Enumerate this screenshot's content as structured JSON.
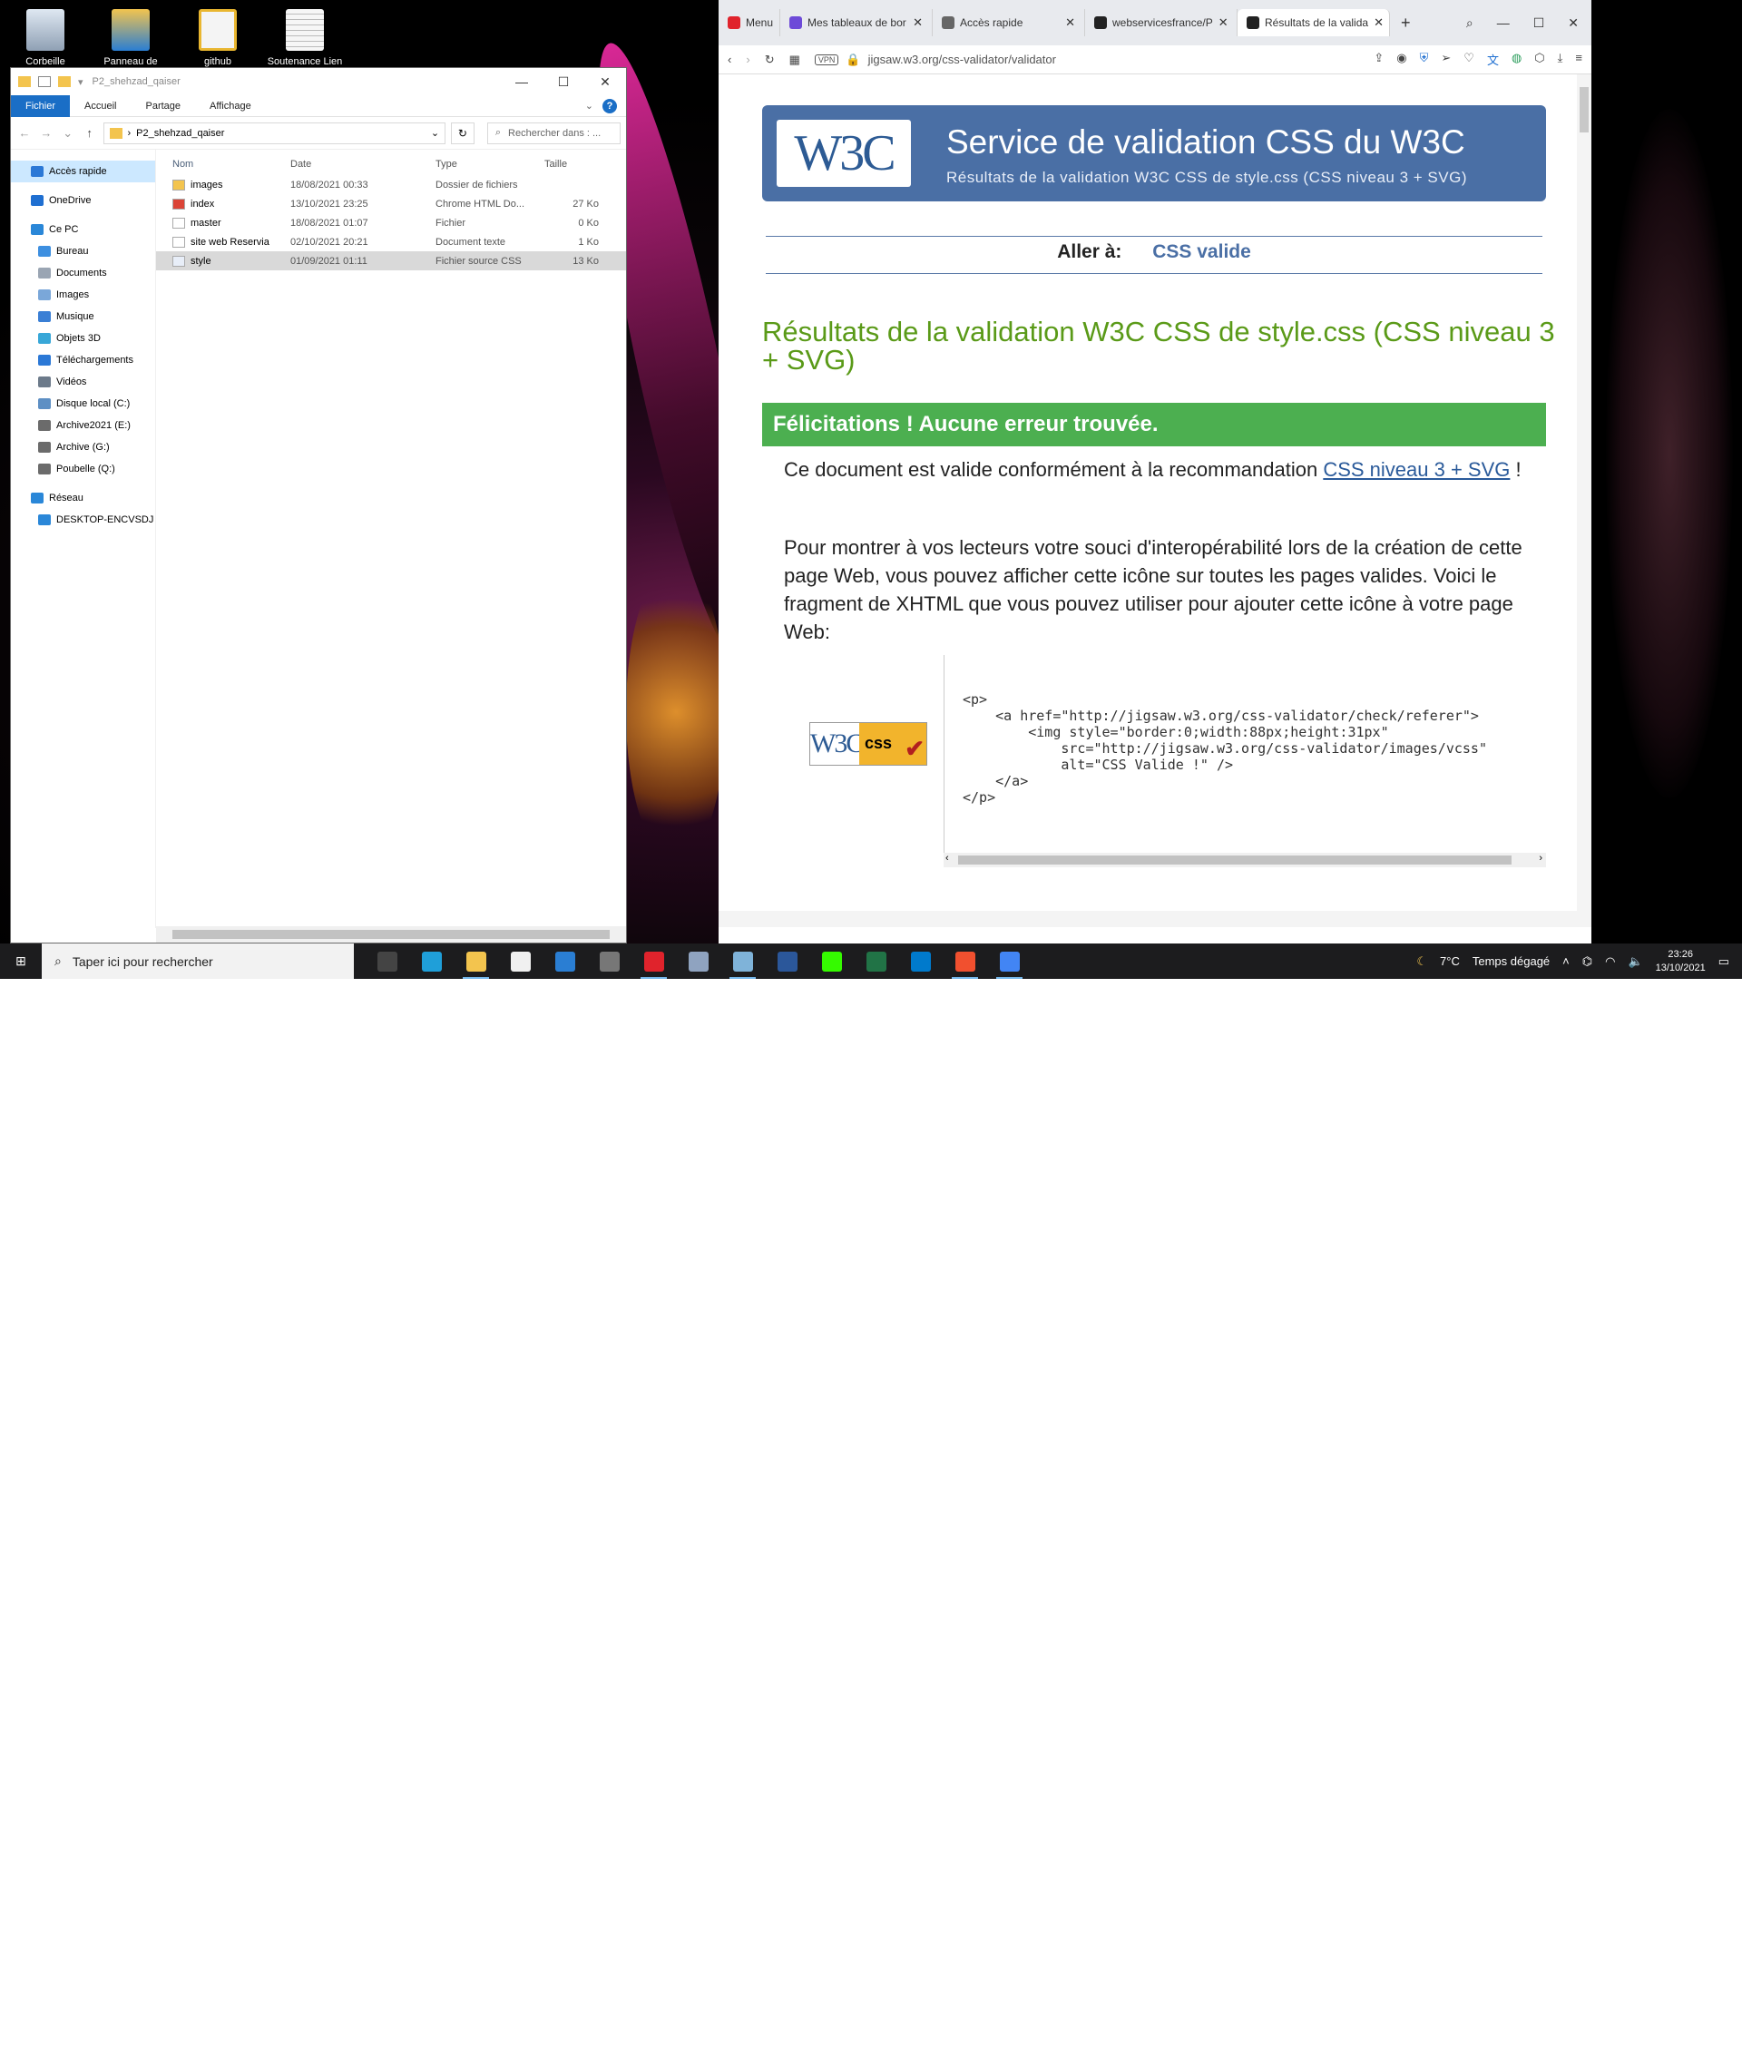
{
  "desktop": {
    "icons": [
      {
        "label": "Corbeille",
        "icon": "recycle-bin-icon"
      },
      {
        "label": "Panneau de",
        "icon": "control-panel-icon"
      },
      {
        "label": "github",
        "icon": "file-icon"
      },
      {
        "label": "Soutenance Lien",
        "icon": "text-file-icon"
      }
    ]
  },
  "explorer": {
    "title": "P2_shehzad_qaiser",
    "ribbon_tabs": [
      "Fichier",
      "Accueil",
      "Partage",
      "Affichage"
    ],
    "path": "P2_shehzad_qaiser",
    "search_placeholder": "Rechercher dans : ...",
    "nav": [
      {
        "label": "Accès rapide",
        "level": 0,
        "selected": true,
        "icon": "star-icon",
        "color": "#2b78d6"
      },
      {
        "label": "OneDrive",
        "level": 0,
        "icon": "cloud-icon",
        "color": "#1f6fd1"
      },
      {
        "label": "Ce PC",
        "level": 0,
        "icon": "computer-icon",
        "color": "#2a87d8"
      },
      {
        "label": "Bureau",
        "level": 1,
        "icon": "desktop-folder-icon",
        "color": "#3d8fe0"
      },
      {
        "label": "Documents",
        "level": 1,
        "icon": "documents-folder-icon",
        "color": "#9aa5b3"
      },
      {
        "label": "Images",
        "level": 1,
        "icon": "pictures-folder-icon",
        "color": "#7aa7d9"
      },
      {
        "label": "Musique",
        "level": 1,
        "icon": "music-folder-icon",
        "color": "#3a7fd5"
      },
      {
        "label": "Objets 3D",
        "level": 1,
        "icon": "3d-objects-icon",
        "color": "#38a7d8"
      },
      {
        "label": "Téléchargements",
        "level": 1,
        "icon": "downloads-icon",
        "color": "#2b78d6"
      },
      {
        "label": "Vidéos",
        "level": 1,
        "icon": "videos-folder-icon",
        "color": "#6c7a8a"
      },
      {
        "label": "Disque local (C:)",
        "level": 1,
        "icon": "drive-icon",
        "color": "#5d8fc4"
      },
      {
        "label": "Archive2021 (E:)",
        "level": 1,
        "icon": "drive-icon",
        "color": "#6b6b6b"
      },
      {
        "label": "Archive (G:)",
        "level": 1,
        "icon": "drive-icon",
        "color": "#6b6b6b"
      },
      {
        "label": "Poubelle (Q:)",
        "level": 1,
        "icon": "drive-icon",
        "color": "#6b6b6b"
      },
      {
        "label": "Réseau",
        "level": 0,
        "icon": "network-icon",
        "color": "#2a87d8"
      },
      {
        "label": "DESKTOP-ENCVSDJ",
        "level": 1,
        "icon": "computer-icon",
        "color": "#2a87d8"
      }
    ],
    "columns": [
      "Nom",
      "Date",
      "Type",
      "Taille"
    ],
    "files": [
      {
        "name": "images",
        "date": "18/08/2021 00:33",
        "type": "Dossier de fichiers",
        "size": "",
        "icon": "folder-icon",
        "color": "#f3c44e"
      },
      {
        "name": "index",
        "date": "13/10/2021 23:25",
        "type": "Chrome HTML Do...",
        "size": "27 Ko",
        "icon": "chrome-icon",
        "color": "#db4437"
      },
      {
        "name": "master",
        "date": "18/08/2021 01:07",
        "type": "Fichier",
        "size": "0 Ko",
        "icon": "file-icon",
        "color": "#ffffff"
      },
      {
        "name": "site web Reservia",
        "date": "02/10/2021 20:21",
        "type": "Document texte",
        "size": "1 Ko",
        "icon": "text-file-icon",
        "color": "#ffffff"
      },
      {
        "name": "style",
        "date": "01/09/2021 01:11",
        "type": "Fichier source CSS",
        "size": "13 Ko",
        "icon": "css-file-icon",
        "color": "#e8eef8",
        "selected": true
      }
    ]
  },
  "browser": {
    "tabs": [
      {
        "label": "Menu",
        "icon": "opera-icon",
        "color": "#e0232c"
      },
      {
        "label": "Mes tableaux de bor",
        "icon": "dashboard-tab-icon",
        "color": "#6d4ad8"
      },
      {
        "label": "Accès rapide",
        "icon": "grid-tab-icon",
        "color": "#666666"
      },
      {
        "label": "webservicesfrance/P",
        "icon": "github-icon",
        "color": "#222222"
      },
      {
        "label": "Résultats de la valida",
        "icon": "w3c-tab-icon",
        "color": "#222222",
        "active": true
      }
    ],
    "url": "jigsaw.w3.org/css-validator/validator",
    "vpn": "VPN",
    "page": {
      "banner_title": "Service de validation CSS du W3C",
      "banner_subtitle": "Résultats de la validation W3C CSS de style.css (CSS niveau 3 + SVG)",
      "logo": "W3C",
      "jump_label": "Aller à:",
      "jump_link": "CSS valide",
      "results_heading": "Résultats de la validation W3C CSS de style.css (CSS niveau 3 + SVG)",
      "congrats": "Félicitations ! Aucune erreur trouvée.",
      "valid_text_before": "Ce document est valide conformément à la recommandation ",
      "valid_link": "CSS niveau 3 + SVG",
      "valid_text_after": " !",
      "info": "Pour montrer à vos lecteurs votre souci d'interopérabilité lors de la création de cette page Web, vous pouvez afficher cette icône sur toutes les pages valides. Voici le fragment de XHTML que vous pouvez utiliser pour ajouter cette icône à votre page Web:",
      "badge_w3c": "W3C",
      "badge_css": "css",
      "code": "<p>\n    <a href=\"http://jigsaw.w3.org/css-validator/check/referer\">\n        <img style=\"border:0;width:88px;height:31px\"\n            src=\"http://jigsaw.w3.org/css-validator/images/vcss\"\n            alt=\"CSS Valide !\" />\n    </a>\n</p>"
    }
  },
  "taskbar": {
    "search_placeholder": "Taper ici pour rechercher",
    "apps": [
      {
        "name": "task-view-icon",
        "color": "#444444",
        "running": false
      },
      {
        "name": "edge-icon",
        "color": "#1f9fd9",
        "running": false
      },
      {
        "name": "file-explorer-icon",
        "color": "#f3c44e",
        "running": true
      },
      {
        "name": "store-icon",
        "color": "#f0f0f0",
        "running": false
      },
      {
        "name": "mail-icon",
        "color": "#2a7ed3",
        "running": false
      },
      {
        "name": "calculator-icon",
        "color": "#777777",
        "running": false
      },
      {
        "name": "opera-icon",
        "color": "#e0232c",
        "running": true
      },
      {
        "name": "app-icon",
        "color": "#8fa3c0",
        "running": false
      },
      {
        "name": "notepad-icon",
        "color": "#7fb3d9",
        "running": true
      },
      {
        "name": "word-icon",
        "color": "#2b579a",
        "running": false
      },
      {
        "name": "dreamweaver-icon",
        "color": "#35fa00",
        "running": false
      },
      {
        "name": "excel-icon",
        "color": "#217346",
        "running": false
      },
      {
        "name": "vscode-icon",
        "color": "#007acc",
        "running": false
      },
      {
        "name": "git-icon",
        "color": "#f1502f",
        "running": true
      },
      {
        "name": "chrome-icon",
        "color": "#4285f4",
        "running": true
      }
    ],
    "weather_temp": "7°C",
    "weather_text": "Temps dégagé",
    "time": "23:26",
    "date": "13/10/2021"
  }
}
